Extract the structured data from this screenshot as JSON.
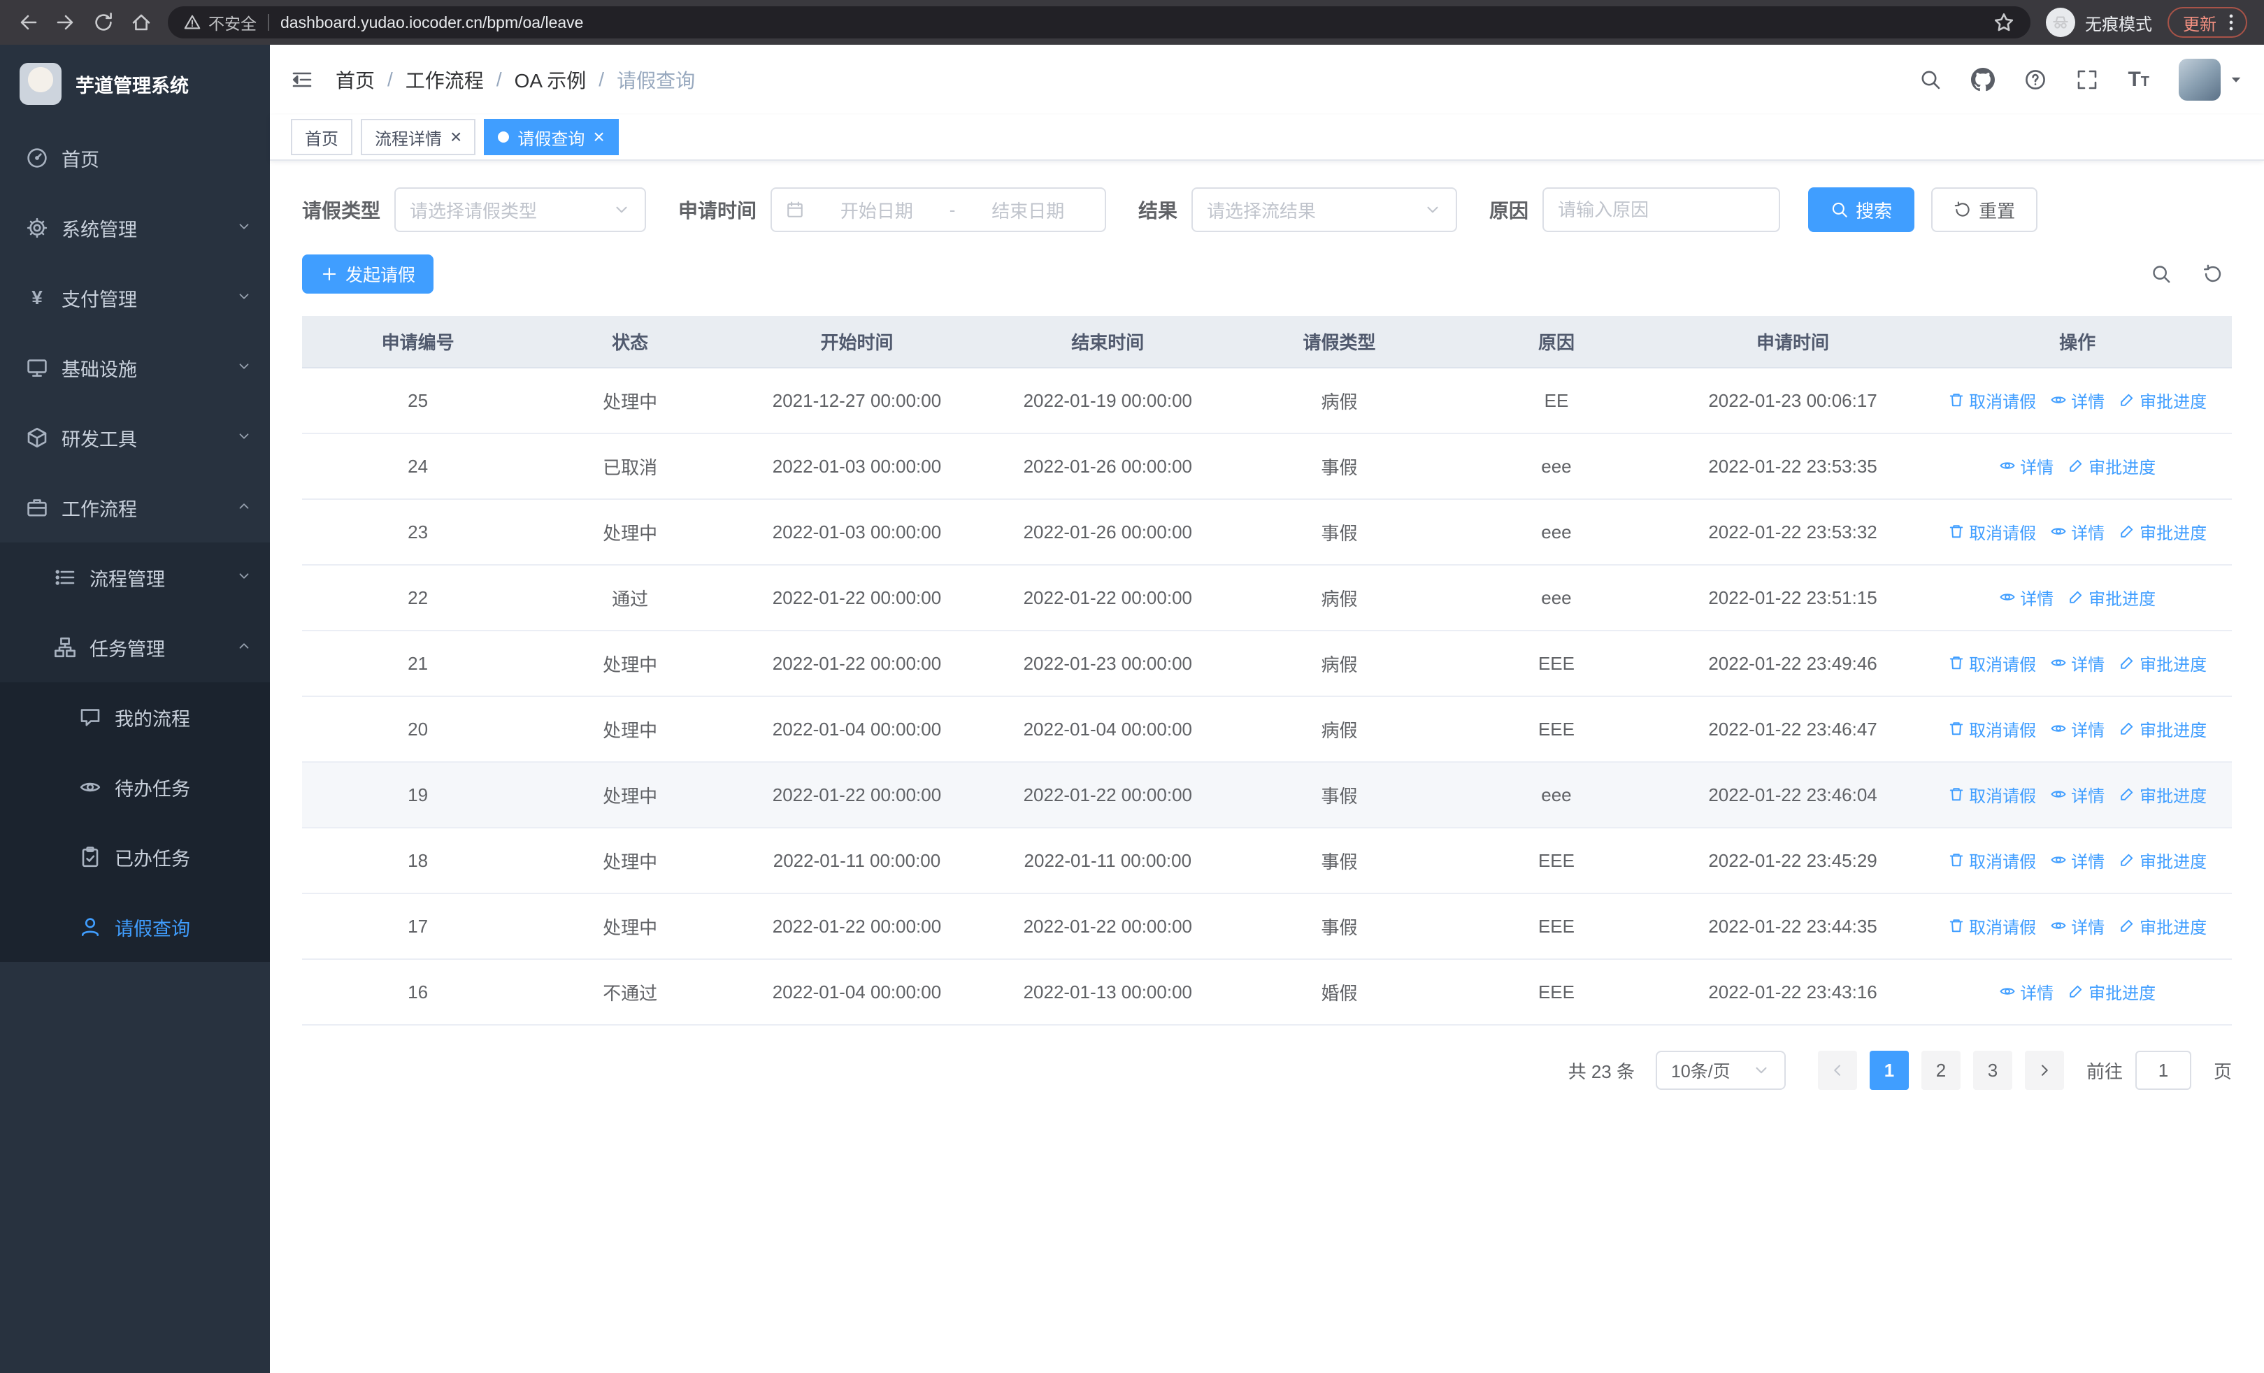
{
  "colors": {
    "primary": "#409eff",
    "sidebar_bg": "#28323f"
  },
  "browser": {
    "security_warning": "不安全",
    "url": "dashboard.yudao.iocoder.cn/bpm/oa/leave",
    "incognito_label": "无痕模式",
    "update_label": "更新"
  },
  "sidebar": {
    "app_title": "芋道管理系统",
    "items": [
      {
        "id": "home",
        "label": "首页",
        "icon": "dashboard-icon",
        "level": 1
      },
      {
        "id": "system",
        "label": "系统管理",
        "icon": "gear-icon",
        "level": 1,
        "arrow": "down"
      },
      {
        "id": "payment",
        "label": "支付管理",
        "icon": "yen-icon",
        "level": 1,
        "arrow": "down"
      },
      {
        "id": "infra",
        "label": "基础设施",
        "icon": "monitor-icon",
        "level": 1,
        "arrow": "down"
      },
      {
        "id": "devtools",
        "label": "研发工具",
        "icon": "cube-icon",
        "level": 1,
        "arrow": "down"
      },
      {
        "id": "workflow",
        "label": "工作流程",
        "icon": "briefcase-icon",
        "level": 1,
        "arrow": "up"
      },
      {
        "id": "process-mgmt",
        "label": "流程管理",
        "icon": "list-icon",
        "level": 2,
        "arrow": "down"
      },
      {
        "id": "task-mgmt",
        "label": "任务管理",
        "icon": "org-icon",
        "level": 2,
        "arrow": "up"
      },
      {
        "id": "my-process",
        "label": "我的流程",
        "icon": "chat-icon",
        "level": 3
      },
      {
        "id": "todo-tasks",
        "label": "待办任务",
        "icon": "eye-icon",
        "level": 3
      },
      {
        "id": "done-tasks",
        "label": "已办任务",
        "icon": "clipboard-check-icon",
        "level": 3
      },
      {
        "id": "leave-query",
        "label": "请假查询",
        "icon": "user-icon",
        "level": 3,
        "active": true
      }
    ]
  },
  "header": {
    "breadcrumb": [
      "首页",
      "工作流程",
      "OA 示例",
      "请假查询"
    ]
  },
  "tabs": [
    {
      "id": "home",
      "label": "首页",
      "closable": false,
      "active": false
    },
    {
      "id": "process-detail",
      "label": "流程详情",
      "closable": true,
      "active": false
    },
    {
      "id": "leave-query",
      "label": "请假查询",
      "closable": true,
      "active": true
    }
  ],
  "filters": {
    "leave_type_label": "请假类型",
    "leave_type_placeholder": "请选择请假类型",
    "apply_time_label": "申请时间",
    "start_date_placeholder": "开始日期",
    "date_separator": "-",
    "end_date_placeholder": "结束日期",
    "result_label": "结果",
    "result_placeholder": "请选择流结果",
    "reason_label": "原因",
    "reason_placeholder": "请输入原因",
    "search_label": "搜索",
    "reset_label": "重置"
  },
  "toolbar": {
    "create_label": "发起请假"
  },
  "table": {
    "columns": [
      "申请编号",
      "状态",
      "开始时间",
      "结束时间",
      "请假类型",
      "原因",
      "申请时间",
      "操作"
    ],
    "rows": [
      {
        "id": "25",
        "status": "处理中",
        "start": "2021-12-27 00:00:00",
        "end": "2022-01-19 00:00:00",
        "type": "病假",
        "reason": "EE",
        "apply_time": "2022-01-23 00:06:17",
        "actions": [
          "取消请假",
          "详情",
          "审批进度"
        ],
        "highlighted": false
      },
      {
        "id": "24",
        "status": "已取消",
        "start": "2022-01-03 00:00:00",
        "end": "2022-01-26 00:00:00",
        "type": "事假",
        "reason": "eee",
        "apply_time": "2022-01-22 23:53:35",
        "actions": [
          "详情",
          "审批进度"
        ],
        "highlighted": false
      },
      {
        "id": "23",
        "status": "处理中",
        "start": "2022-01-03 00:00:00",
        "end": "2022-01-26 00:00:00",
        "type": "事假",
        "reason": "eee",
        "apply_time": "2022-01-22 23:53:32",
        "actions": [
          "取消请假",
          "详情",
          "审批进度"
        ],
        "highlighted": false
      },
      {
        "id": "22",
        "status": "通过",
        "start": "2022-01-22 00:00:00",
        "end": "2022-01-22 00:00:00",
        "type": "病假",
        "reason": "eee",
        "apply_time": "2022-01-22 23:51:15",
        "actions": [
          "详情",
          "审批进度"
        ],
        "highlighted": false
      },
      {
        "id": "21",
        "status": "处理中",
        "start": "2022-01-22 00:00:00",
        "end": "2022-01-23 00:00:00",
        "type": "病假",
        "reason": "EEE",
        "apply_time": "2022-01-22 23:49:46",
        "actions": [
          "取消请假",
          "详情",
          "审批进度"
        ],
        "highlighted": false
      },
      {
        "id": "20",
        "status": "处理中",
        "start": "2022-01-04 00:00:00",
        "end": "2022-01-04 00:00:00",
        "type": "病假",
        "reason": "EEE",
        "apply_time": "2022-01-22 23:46:47",
        "actions": [
          "取消请假",
          "详情",
          "审批进度"
        ],
        "highlighted": false
      },
      {
        "id": "19",
        "status": "处理中",
        "start": "2022-01-22 00:00:00",
        "end": "2022-01-22 00:00:00",
        "type": "事假",
        "reason": "eee",
        "apply_time": "2022-01-22 23:46:04",
        "actions": [
          "取消请假",
          "详情",
          "审批进度"
        ],
        "highlighted": true
      },
      {
        "id": "18",
        "status": "处理中",
        "start": "2022-01-11 00:00:00",
        "end": "2022-01-11 00:00:00",
        "type": "事假",
        "reason": "EEE",
        "apply_time": "2022-01-22 23:45:29",
        "actions": [
          "取消请假",
          "详情",
          "审批进度"
        ],
        "highlighted": false
      },
      {
        "id": "17",
        "status": "处理中",
        "start": "2022-01-22 00:00:00",
        "end": "2022-01-22 00:00:00",
        "type": "事假",
        "reason": "EEE",
        "apply_time": "2022-01-22 23:44:35",
        "actions": [
          "取消请假",
          "详情",
          "审批进度"
        ],
        "highlighted": false
      },
      {
        "id": "16",
        "status": "不通过",
        "start": "2022-01-04 00:00:00",
        "end": "2022-01-13 00:00:00",
        "type": "婚假",
        "reason": "EEE",
        "apply_time": "2022-01-22 23:43:16",
        "actions": [
          "详情",
          "审批进度"
        ],
        "highlighted": false
      }
    ]
  },
  "actions_meta": {
    "取消请假": {
      "icon": "trash-icon",
      "name": "cancel-leave-link"
    },
    "详情": {
      "icon": "eye-icon",
      "name": "detail-link"
    },
    "审批进度": {
      "icon": "pen-icon",
      "name": "approval-progress-link"
    }
  },
  "pagination": {
    "total_text": "共 23 条",
    "page_size": "10条/页",
    "pages": [
      "1",
      "2",
      "3"
    ],
    "active_page": "1",
    "goto_label": "前往",
    "goto_value": "1",
    "page_suffix": "页"
  }
}
